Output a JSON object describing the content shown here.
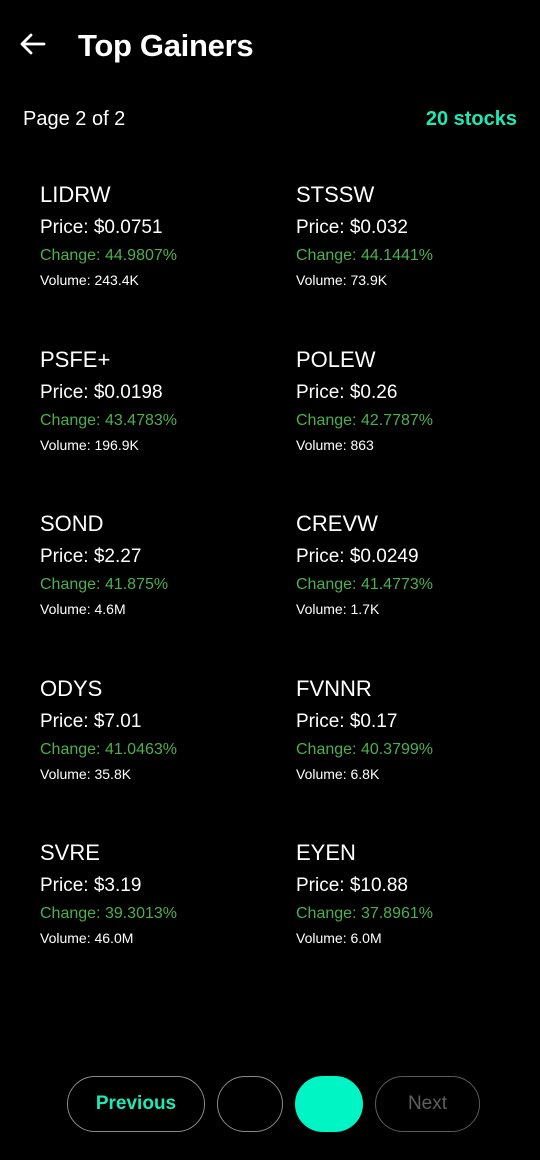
{
  "header": {
    "title": "Top Gainers",
    "back_icon": "arrow-left-icon"
  },
  "subheader": {
    "page_label": "Page 2 of 2",
    "count_label": "20 stocks"
  },
  "colors": {
    "accent": "#1de9b6",
    "positive": "#4caf50",
    "background": "#000000"
  },
  "stocks": [
    {
      "ticker": "LIDRW",
      "price": "Price: $0.0751",
      "change": "Change: 44.9807%",
      "volume": "Volume: 243.4K"
    },
    {
      "ticker": "STSSW",
      "price": "Price: $0.032",
      "change": "Change: 44.1441%",
      "volume": "Volume: 73.9K"
    },
    {
      "ticker": "PSFE+",
      "price": "Price: $0.0198",
      "change": "Change: 43.4783%",
      "volume": "Volume: 196.9K"
    },
    {
      "ticker": "POLEW",
      "price": "Price: $0.26",
      "change": "Change: 42.7787%",
      "volume": "Volume: 863"
    },
    {
      "ticker": "SOND",
      "price": "Price: $2.27",
      "change": "Change: 41.875%",
      "volume": "Volume: 4.6M"
    },
    {
      "ticker": "CREVW",
      "price": "Price: $0.0249",
      "change": "Change: 41.4773%",
      "volume": "Volume: 1.7K"
    },
    {
      "ticker": "ODYS",
      "price": "Price: $7.01",
      "change": "Change: 41.0463%",
      "volume": "Volume: 35.8K"
    },
    {
      "ticker": "FVNNR",
      "price": "Price: $0.17",
      "change": "Change: 40.3799%",
      "volume": "Volume: 6.8K"
    },
    {
      "ticker": "SVRE",
      "price": "Price: $3.19",
      "change": "Change: 39.3013%",
      "volume": "Volume: 46.0M"
    },
    {
      "ticker": "EYEN",
      "price": "Price: $10.88",
      "change": "Change: 37.8961%",
      "volume": "Volume: 6.0M"
    }
  ],
  "pagination": {
    "previous_label": "Previous",
    "page1_label": "",
    "page2_label": "",
    "next_label": "Next",
    "current_page": 2
  }
}
